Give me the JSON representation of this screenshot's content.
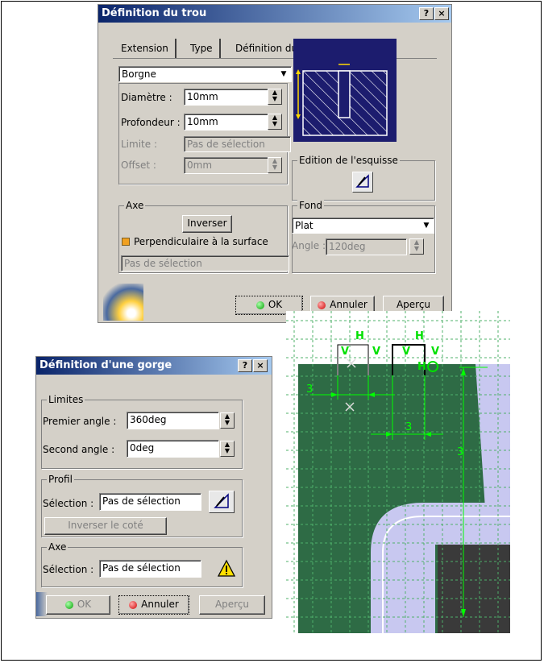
{
  "dialog1": {
    "title": "Définition du trou",
    "title_buttons": [
      "?",
      "×"
    ],
    "tabs": [
      {
        "label": "Extension"
      },
      {
        "label": "Type"
      },
      {
        "label": "Définition du taraudage"
      }
    ],
    "extension_type": "Borgne",
    "diameter_label": "Diamètre :",
    "diameter_value": "10mm",
    "depth_label": "Profondeur :",
    "depth_value": "10mm",
    "limit_label": "Limite :",
    "limit_value": "Pas de sélection",
    "offset_label": "Offset :",
    "offset_value": "0mm",
    "sketch_group_label": "Edition de l'esquisse",
    "axis_group_label": "Axe",
    "invert_button": "Inverser",
    "perpendicular_label": "Perpendiculaire à la surface",
    "axis_selection": "Pas de sélection",
    "bottom_group_label": "Fond",
    "bottom_type": "Plat",
    "angle_label": "Angle :",
    "angle_value": "120deg",
    "ok_button": "OK",
    "cancel_button": "Annuler",
    "preview_button": "Aperçu"
  },
  "dialog2": {
    "title": "Définition d'une gorge",
    "title_buttons": [
      "?",
      "×"
    ],
    "limits_group_label": "Limites",
    "first_angle_label": "Premier angle :",
    "first_angle_value": "360deg",
    "second_angle_label": "Second angle :",
    "second_angle_value": "0deg",
    "profile_group_label": "Profil",
    "profile_selection_label": "Sélection :",
    "profile_selection_value": "Pas de sélection",
    "reverse_side_button": "Inverser le coté",
    "axis_group_label": "Axe",
    "axis_selection_label": "Sélection :",
    "axis_selection_value": "Pas de sélection",
    "ok_button": "OK",
    "cancel_button": "Annuler",
    "preview_button": "Aperçu"
  },
  "viewport": {
    "constraint_h": "H",
    "constraint_v": "V",
    "constraint_hc": "H",
    "dim_left": "3",
    "dim_mid": "3",
    "dim_right": "3"
  },
  "colors": {
    "title_blue": "#0a246a",
    "dialog_gray": "#d4d0c8",
    "part_green": "#2e6b45",
    "grid_line": "#4fb06a",
    "constraint_green": "#00e000",
    "dimension_green": "#00ff00",
    "part_blue": "#c8c8f0"
  }
}
